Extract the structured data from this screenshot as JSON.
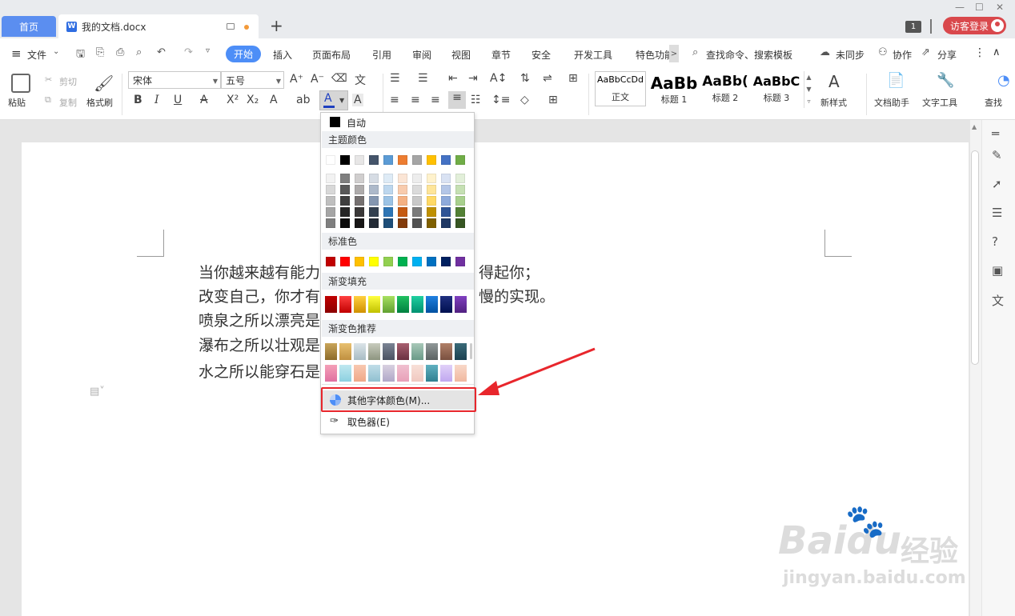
{
  "titlebar": {
    "home_tab": "首页",
    "doc_tab": "我的文档.docx",
    "doc_icon": "W",
    "new_tab": "+",
    "badge": "1",
    "guest_login": "访客登录",
    "minimize": "—",
    "maximize": "☐",
    "close": "✕"
  },
  "menubar": {
    "hamburger": "≡",
    "file": "文件",
    "items": [
      "开始",
      "插入",
      "页面布局",
      "引用",
      "审阅",
      "视图",
      "章节",
      "安全",
      "开发工具",
      "特色功能"
    ],
    "more": ">",
    "search": "查找命令、搜索模板",
    "sync": "未同步",
    "collab": "协作",
    "share": "分享",
    "kebab": "⋮",
    "collapse": "∧"
  },
  "ribbon": {
    "paste": "粘贴",
    "cut": "剪切",
    "copy": "复制",
    "format_painter": "格式刷",
    "font_name": "宋体",
    "font_size": "五号",
    "bold": "B",
    "italic": "I",
    "underline": "U",
    "styles": [
      {
        "sample": "AaBbCcDd",
        "label": "正文"
      },
      {
        "sample": "AaBb",
        "label": "标题 1"
      },
      {
        "sample": "AaBb(",
        "label": "标题 2"
      },
      {
        "sample": "AaBbC",
        "label": "标题 3"
      }
    ],
    "new_style": "新样式",
    "doc_helper": "文档助手",
    "text_tools": "文字工具",
    "find_replace": "查找"
  },
  "document": {
    "lines": [
      "当你越来越有能力",
      "改变自己，你才有",
      "喷泉之所以漂亮是",
      "瀑布之所以壮观是",
      "水之所以能穿石是"
    ],
    "line_tails": [
      "得起你；",
      "慢的实现。"
    ]
  },
  "font_color_menu": {
    "auto_label": "自动",
    "theme_header": "主题颜色",
    "standard_header": "标准色",
    "gradient_fill_header": "渐变填充",
    "gradient_recommend_header": "渐变色推荐",
    "more_colors": "其他字体颜色(M)...",
    "eyedropper": "取色器(E)",
    "theme_top_row": [
      "#ffffff",
      "#000000",
      "#e7e6e6",
      "#44546a",
      "#5b9bd5",
      "#ed7d31",
      "#a5a5a5",
      "#ffc000",
      "#4472c4",
      "#70ad47"
    ],
    "theme_shades": [
      [
        "#f2f2f2",
        "#7f7f7f",
        "#d0cece",
        "#d6dce4",
        "#deebf6",
        "#fbe5d5",
        "#ededed",
        "#fff2cc",
        "#d9e2f3",
        "#e2efd9"
      ],
      [
        "#d8d8d8",
        "#595959",
        "#aeabab",
        "#adb9ca",
        "#bdd7ee",
        "#f8cbad",
        "#dbdbdb",
        "#fee599",
        "#b4c6e7",
        "#c5e0b3"
      ],
      [
        "#bfbfbf",
        "#3f3f3f",
        "#757070",
        "#8496b0",
        "#9cc3e5",
        "#f4b183",
        "#c9c9c9",
        "#ffd965",
        "#8eaadb",
        "#a8d08d"
      ],
      [
        "#a5a5a5",
        "#262626",
        "#3a3838",
        "#323f4f",
        "#2e75b5",
        "#c55a11",
        "#7b7b7b",
        "#bf9000",
        "#2f5496",
        "#538135"
      ],
      [
        "#7f7f7f",
        "#0c0c0c",
        "#171616",
        "#222a35",
        "#1e4e79",
        "#833c0b",
        "#525252",
        "#7f6000",
        "#1f3864",
        "#375623"
      ]
    ],
    "standard_colors": [
      "#c00000",
      "#ff0000",
      "#ffc000",
      "#ffff00",
      "#92d050",
      "#00b050",
      "#00b0f0",
      "#0070c0",
      "#002060",
      "#7030a0"
    ],
    "gradient_fill": [
      [
        "#c00000",
        "#8b0000"
      ],
      [
        "#ff4040",
        "#c00000"
      ],
      [
        "#ffd040",
        "#d09000"
      ],
      [
        "#ffff40",
        "#c0c000"
      ],
      [
        "#a8e060",
        "#60a030"
      ],
      [
        "#20c060",
        "#008040"
      ],
      [
        "#20d0a0",
        "#009070"
      ],
      [
        "#2080e0",
        "#0050a0"
      ],
      [
        "#203080",
        "#001050"
      ],
      [
        "#8040c0",
        "#502080"
      ]
    ],
    "gradient_recommend_row1": [
      [
        "#c9a55a",
        "#8c6a2a"
      ],
      [
        "#e8c070",
        "#c09040"
      ],
      [
        "#dbe4e8",
        "#a8bcc4"
      ],
      [
        "#c8cbbd",
        "#8d9580"
      ],
      [
        "#7b8494",
        "#4a5262"
      ],
      [
        "#a86070",
        "#6a3040"
      ],
      [
        "#a8c8b8",
        "#6a9a88"
      ],
      [
        "#909898",
        "#5a6262"
      ],
      [
        "#b08068",
        "#7a5040"
      ],
      [
        "#3a6a78",
        "#1a4050"
      ]
    ],
    "gradient_recommend_row2": [
      [
        "#f4a0b8",
        "#e070a0"
      ],
      [
        "#bfe8f0",
        "#8cd0e0"
      ],
      [
        "#f8c8b0",
        "#f0a888"
      ],
      [
        "#c0dde8",
        "#90c0d0"
      ],
      [
        "#d8d0e0",
        "#b0a8c8"
      ],
      [
        "#f0c0d0",
        "#e8a0b8"
      ],
      [
        "#f8e0d8",
        "#f0c8c0"
      ],
      [
        "#60b0c0",
        "#308090"
      ],
      [
        "#e0d0f8",
        "#c0a8f0"
      ],
      [
        "#f8d8c8",
        "#f0b8a0"
      ]
    ]
  },
  "watermark": {
    "brand": "Baidu",
    "cn": "经验",
    "url": "jingyan.baidu.com"
  },
  "colors": {
    "accent": "#4d8ef7",
    "highlight": "#e8262c",
    "guest": "#d9484c"
  }
}
